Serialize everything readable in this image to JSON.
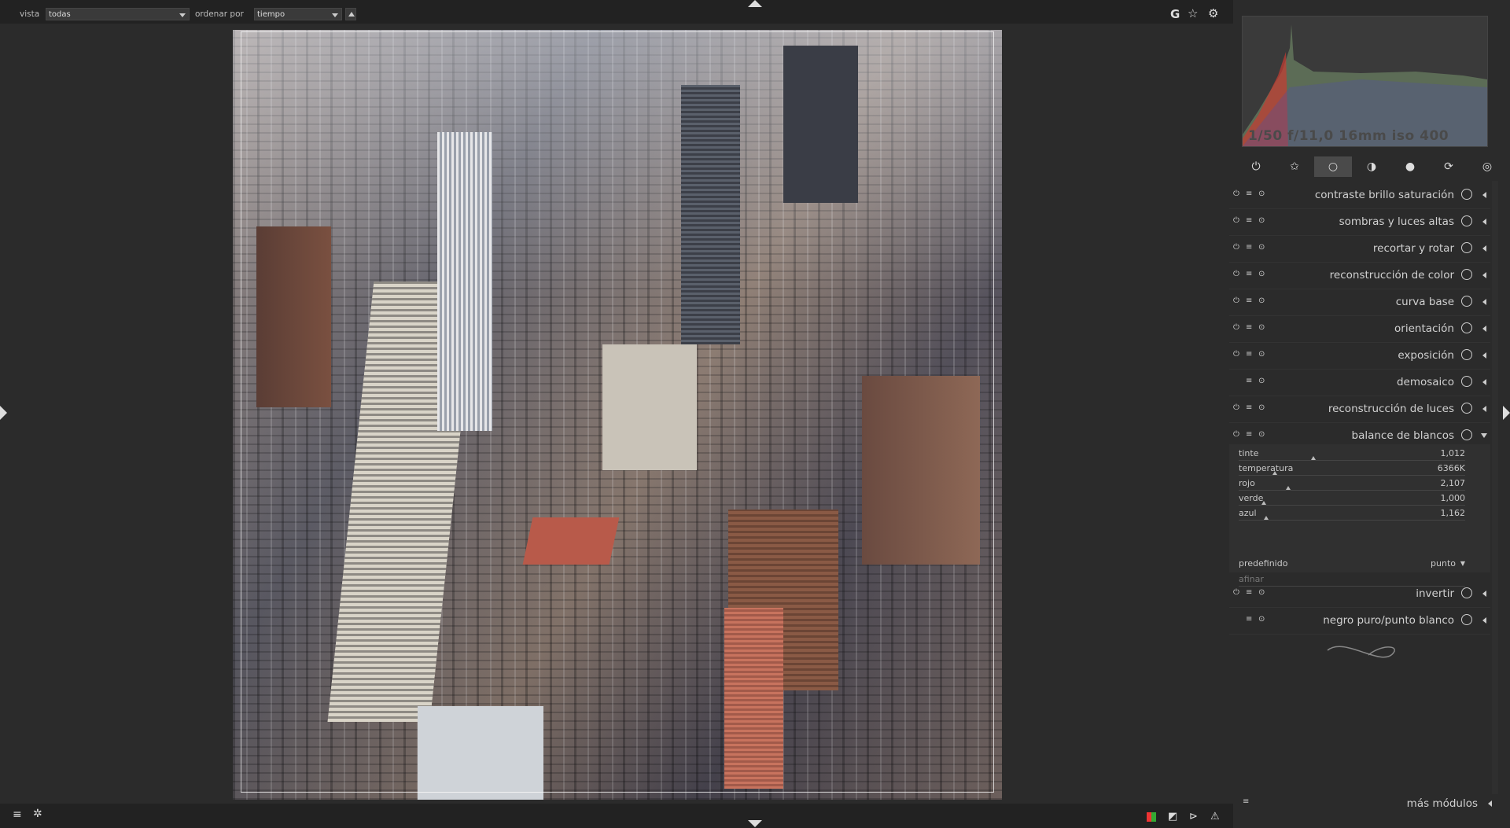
{
  "topbar": {
    "view_label": "vista",
    "view_value": "todas",
    "sort_label": "ordenar por",
    "sort_value": "tiempo",
    "right_icons": [
      "grouping-icon",
      "star-overlay-icon",
      "gear-icon"
    ],
    "grouping_letter": "G"
  },
  "histogram": {
    "exif_text": "1/50 f/11,0 16mm iso 400"
  },
  "module_tabs": [
    {
      "name": "power-icon",
      "glyph": "⏻"
    },
    {
      "name": "favorites-icon",
      "glyph": "✩"
    },
    {
      "name": "basic-icon",
      "glyph": "○",
      "active": true
    },
    {
      "name": "tone-icon",
      "glyph": "◑"
    },
    {
      "name": "color-icon",
      "glyph": "●"
    },
    {
      "name": "correct-icon",
      "glyph": "⟳"
    },
    {
      "name": "effect-icon",
      "glyph": "◎"
    }
  ],
  "modules": [
    {
      "name": "contraste brillo saturación",
      "icon": "contrast-icon"
    },
    {
      "name": "sombras y luces altas",
      "icon": "shadows-icon"
    },
    {
      "name": "recortar y rotar",
      "icon": "crop-icon"
    },
    {
      "name": "reconstrucción de color",
      "icon": "color-reconstruction-icon"
    },
    {
      "name": "curva base",
      "icon": "curve-icon"
    },
    {
      "name": "orientación",
      "icon": "orientation-icon"
    },
    {
      "name": "exposición",
      "icon": "exposure-icon"
    },
    {
      "name": "demosaico",
      "icon": "demosaic-icon"
    },
    {
      "name": "reconstrucción de luces",
      "icon": "highlight-icon"
    },
    {
      "name": "balance de blancos",
      "icon": "white-balance-icon",
      "expanded": true
    },
    {
      "name": "invertir",
      "icon": "invert-icon"
    },
    {
      "name": "negro puro/punto blanco",
      "icon": "rawprepare-icon"
    }
  ],
  "white_balance": {
    "sliders": [
      {
        "label": "tinte",
        "value": "1,012",
        "fraction": 0.33
      },
      {
        "label": "temperatura",
        "value": "6366K",
        "fraction": 0.16
      },
      {
        "label": "rojo",
        "value": "2,107",
        "fraction": 0.22
      },
      {
        "label": "verde",
        "value": "1,000",
        "fraction": 0.11
      },
      {
        "label": "azul",
        "value": "1,162",
        "fraction": 0.12
      }
    ],
    "preset_label": "predefinido",
    "preset_value": "punto",
    "finetune_label": "afinar"
  },
  "more_modules_label": "más módulos",
  "colors": {
    "panel_bg": "#2b2b2b",
    "bar_bg": "#222222",
    "active_tab": "#4a4a4a"
  }
}
